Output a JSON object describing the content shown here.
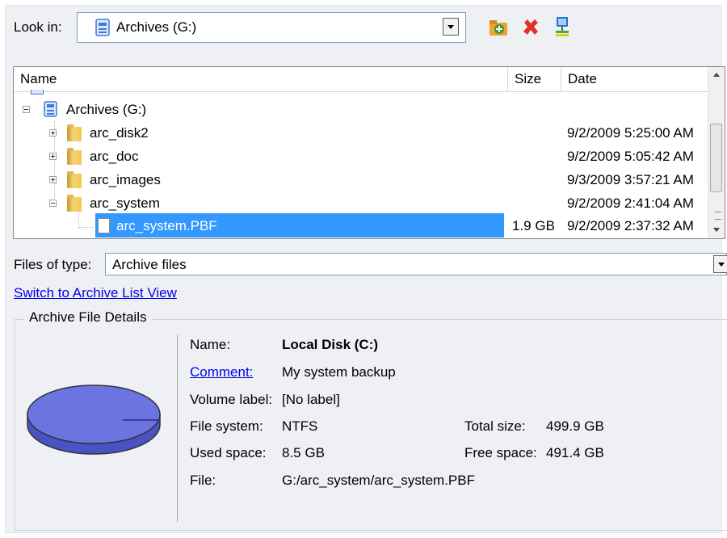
{
  "look_in": {
    "label": "Look in:",
    "value": "Archives (G:)"
  },
  "toolbar": {
    "icons": [
      "new-folder-icon",
      "delete-icon",
      "network-icon"
    ],
    "colors": {
      "new_folder": "#3c9a3c",
      "delete": "#e0342b",
      "network": "#2a6fc9"
    }
  },
  "list": {
    "headers": {
      "name": "Name",
      "size": "Size",
      "date": "Date"
    },
    "rows": [
      {
        "name": "Archives (G:)",
        "size": "",
        "date": ""
      },
      {
        "name": "arc_disk2",
        "size": "",
        "date": "9/2/2009 5:25:00 AM"
      },
      {
        "name": "arc_doc",
        "size": "",
        "date": "9/2/2009 5:05:42 AM"
      },
      {
        "name": "arc_images",
        "size": "",
        "date": "9/3/2009 3:57:21 AM"
      },
      {
        "name": "arc_system",
        "size": "",
        "date": "9/2/2009 2:41:04 AM"
      },
      {
        "name": "arc_system.PBF",
        "size": "1.9 GB",
        "date": "9/2/2009 2:37:32 AM"
      }
    ],
    "selected_color": "#3399ff"
  },
  "files_of_type": {
    "label": "Files of type:",
    "value": "Archive files"
  },
  "switch_link": "Switch to Archive List View",
  "details": {
    "legend": "Archive File Details",
    "name_label": "Name:",
    "name_value": "Local Disk (C:)",
    "comment_label": "Comment:",
    "comment_value": "My system backup",
    "volume_label": "Volume label:",
    "volume_value": "[No label]",
    "fs_label": "File system:",
    "fs_value": "NTFS",
    "used_label": "Used space:",
    "used_value": "8.5 GB",
    "file_label": "File:",
    "file_value": "G:/arc_system/arc_system.PBF",
    "total_label": "Total size:",
    "total_value": "499.9 GB",
    "free_label": "Free space:",
    "free_value": "491.4 GB",
    "disk_color": "#6b74e0"
  }
}
